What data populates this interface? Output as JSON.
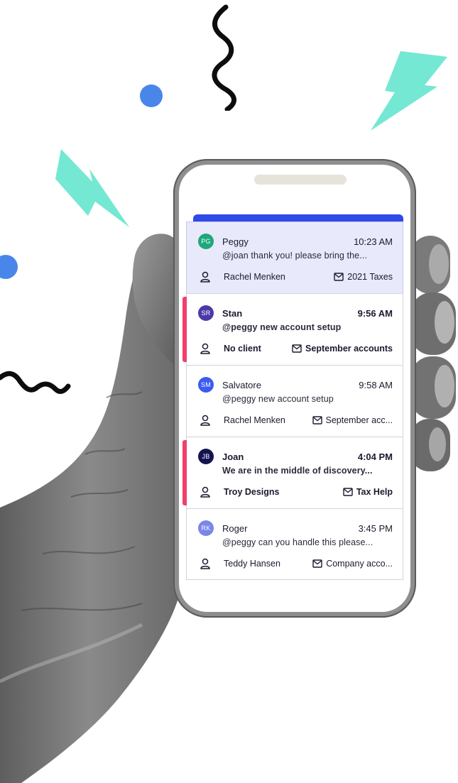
{
  "colors": {
    "accent_blue": "#2f4ae8",
    "unread_marker": "#f0406a",
    "selected_bg": "#e8e9fb",
    "teal_decoration": "#74e8d2",
    "blue_dot": "#4a86ea"
  },
  "messages": [
    {
      "initials": "PG",
      "avatar_color": "#1fa77a",
      "sender": "Peggy",
      "time": "10:23 AM",
      "preview": "@joan thank you! please bring the...",
      "client": "Rachel Menken",
      "subject": "2021 Taxes",
      "unread": false,
      "selected": true
    },
    {
      "initials": "SR",
      "avatar_color": "#4a3aa8",
      "sender": "Stan",
      "time": "9:56 AM",
      "preview": "@peggy new account setup",
      "client": "No client",
      "subject": "September accounts",
      "unread": true,
      "selected": false
    },
    {
      "initials": "SM",
      "avatar_color": "#3b5bf0",
      "sender": "Salvatore",
      "time": "9:58 AM",
      "preview": "@peggy new account setup",
      "client": "Rachel Menken",
      "subject": "September acc...",
      "unread": false,
      "selected": false
    },
    {
      "initials": "JB",
      "avatar_color": "#141452",
      "sender": "Joan",
      "time": "4:04 PM",
      "preview": "We are in the middle of discovery...",
      "client": "Troy Designs",
      "subject": "Tax Help",
      "unread": true,
      "selected": false
    },
    {
      "initials": "RK",
      "avatar_color": "#7a86e8",
      "sender": "Roger",
      "time": "3:45 PM",
      "preview": "@peggy can you handle this please...",
      "client": "Teddy Hansen",
      "subject": "Company acco...",
      "unread": false,
      "selected": false
    }
  ]
}
